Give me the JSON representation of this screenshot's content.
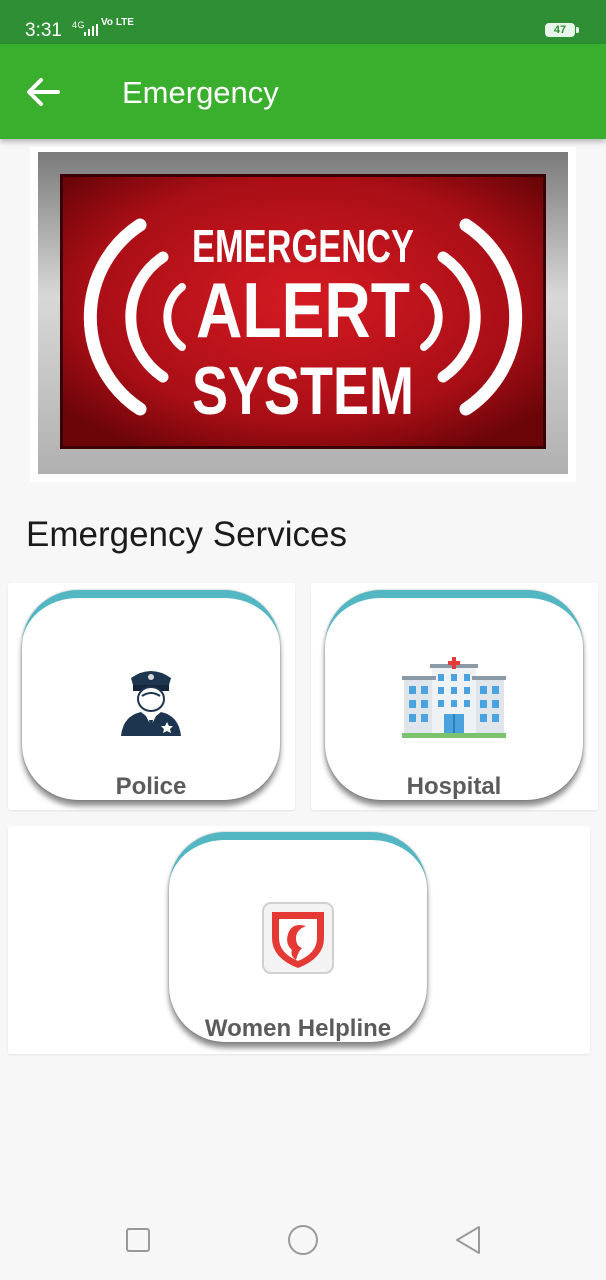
{
  "status_bar": {
    "time": "3:31",
    "network": "4G",
    "volte": "Vo LTE",
    "battery": "47"
  },
  "app_bar": {
    "title": "Emergency",
    "back_icon": "arrow-left-icon"
  },
  "banner": {
    "line1": "EMERGENCY",
    "line2": "ALERT",
    "line3": "SYSTEM"
  },
  "section_title": "Emergency Services",
  "services": [
    {
      "label": "Police",
      "icon": "police-officer-icon"
    },
    {
      "label": "Hospital",
      "icon": "hospital-building-icon"
    },
    {
      "label": "Women Helpline",
      "icon": "women-helpline-shield-icon"
    }
  ],
  "colors": {
    "status_bar": "#2e8f34",
    "app_bar": "#3aaf2d",
    "card_accent": "#52b6c3",
    "banner_red": "#b3121a"
  },
  "nav": {
    "recents_icon": "square-icon",
    "home_icon": "circle-icon",
    "back_icon": "triangle-back-icon"
  }
}
